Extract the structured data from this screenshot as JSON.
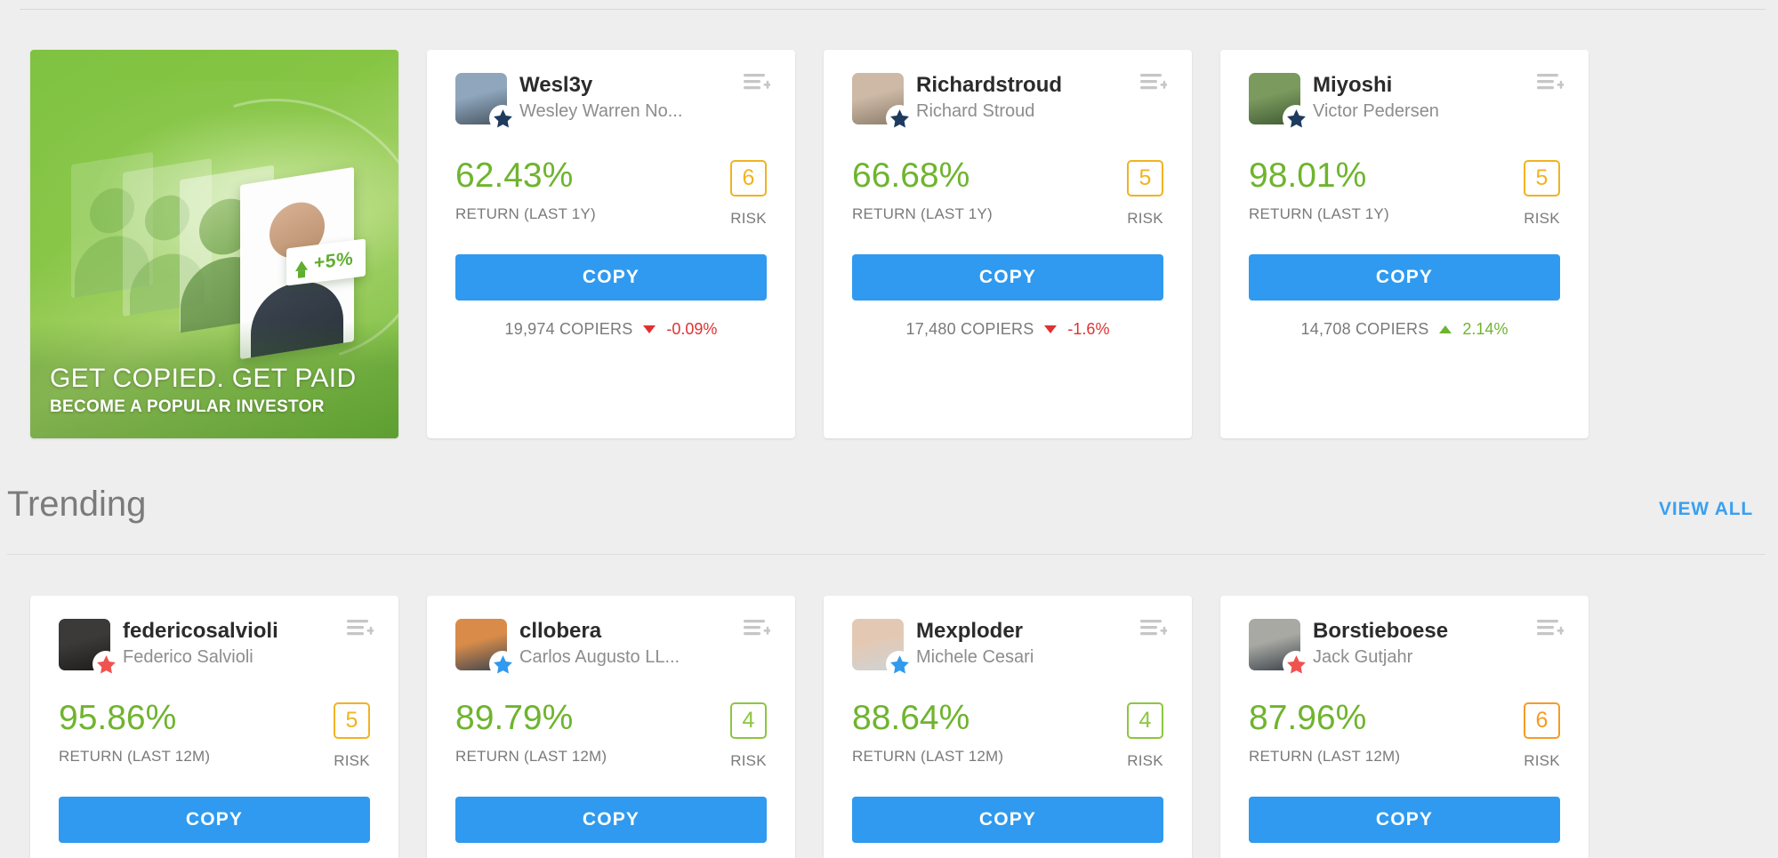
{
  "promo": {
    "title": "GET COPIED. GET PAID",
    "subtitle": "BECOME A POPULAR INVESTOR",
    "badge_pct": "+5%",
    "up_arrow_icon": "up-arrow-icon"
  },
  "labels": {
    "copy": "COPY",
    "risk": "RISK",
    "add_to_list_icon": "add-to-list-icon",
    "star_icon": "star-badge-icon"
  },
  "trending": {
    "title": "Trending",
    "view_all": "VIEW ALL"
  },
  "colors": {
    "accent_blue": "#2f9aef",
    "link_blue": "#3aa0f0",
    "positive_green": "#6fb42e",
    "negative_red": "#e03131",
    "risk_amber": "#f0b323",
    "risk_green": "#8cc63e",
    "risk_orange": "#f59b26",
    "star_navy": "#1f3a5f",
    "star_blue": "#2f9aef",
    "star_red": "#ef5350"
  },
  "featured_cards": [
    {
      "username": "Wesl3y",
      "fullname": "Wesley Warren No...",
      "return_value": "62.43%",
      "return_label": "RETURN (LAST 1Y)",
      "risk": "6",
      "risk_color": "#f0b323",
      "copiers": "19,974 COPIERS",
      "change": "-0.09%",
      "direction": "down",
      "star_color": "#1f3a5f",
      "avatar_top": "#8fa6bd",
      "avatar_bottom": "#46545f"
    },
    {
      "username": "Richardstroud",
      "fullname": "Richard Stroud",
      "return_value": "66.68%",
      "return_label": "RETURN (LAST 1Y)",
      "risk": "5",
      "risk_color": "#f0b323",
      "copiers": "17,480 COPIERS",
      "change": "-1.6%",
      "direction": "down",
      "star_color": "#1f3a5f",
      "avatar_top": "#cdb9a6",
      "avatar_bottom": "#8d7c6b"
    },
    {
      "username": "Miyoshi",
      "fullname": "Victor Pedersen",
      "return_value": "98.01%",
      "return_label": "RETURN (LAST 1Y)",
      "risk": "5",
      "risk_color": "#f0b323",
      "copiers": "14,708 COPIERS",
      "change": "2.14%",
      "direction": "up",
      "star_color": "#1f3a5f",
      "avatar_top": "#7b9a5e",
      "avatar_bottom": "#3f5a33"
    }
  ],
  "trending_cards": [
    {
      "username": "federicosalvioli",
      "fullname": "Federico Salvioli",
      "return_value": "95.86%",
      "return_label": "RETURN (LAST 12M)",
      "risk": "5",
      "risk_color": "#f0b323",
      "star_color": "#ef5350",
      "avatar_top": "#3b3a38",
      "avatar_bottom": "#1d1c1b"
    },
    {
      "username": "cllobera",
      "fullname": "Carlos Augusto LL...",
      "return_value": "89.79%",
      "return_label": "RETURN (LAST 12M)",
      "risk": "4",
      "risk_color": "#8cc63e",
      "star_color": "#2f9aef",
      "avatar_top": "#d98c4a",
      "avatar_bottom": "#3c4450"
    },
    {
      "username": "Mexploder",
      "fullname": "Michele Cesari",
      "return_value": "88.64%",
      "return_label": "RETURN (LAST 12M)",
      "risk": "4",
      "risk_color": "#8cc63e",
      "star_color": "#2f9aef",
      "avatar_top": "#e3c9b4",
      "avatar_bottom": "#cfd3d6"
    },
    {
      "username": "Borstieboese",
      "fullname": "Jack Gutjahr",
      "return_value": "87.96%",
      "return_label": "RETURN (LAST 12M)",
      "risk": "6",
      "risk_color": "#f59b26",
      "star_color": "#ef5350",
      "avatar_top": "#a8a9a3",
      "avatar_bottom": "#3a4149"
    }
  ]
}
